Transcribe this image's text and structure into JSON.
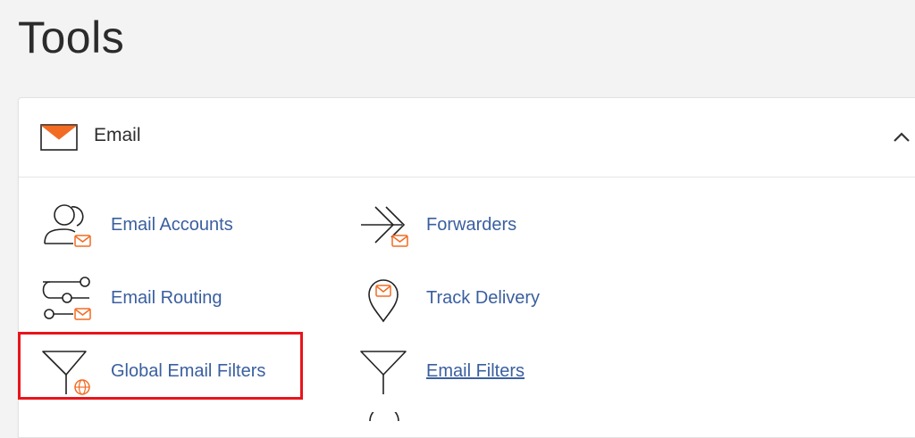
{
  "page": {
    "title": "Tools"
  },
  "email_section": {
    "title": "Email",
    "icon": "envelope-icon",
    "collapse_icon": "chevron-up-icon",
    "tools": [
      {
        "label": "Email Accounts",
        "icon": "email-accounts-icon"
      },
      {
        "label": "Forwarders",
        "icon": "forwarders-icon"
      },
      {
        "label": "Email Routing",
        "icon": "email-routing-icon"
      },
      {
        "label": "Track Delivery",
        "icon": "track-delivery-icon"
      },
      {
        "label": "Global Email Filters",
        "icon": "global-email-filters-icon",
        "highlighted": true
      },
      {
        "label": "Email Filters",
        "icon": "email-filters-icon"
      }
    ]
  },
  "colors": {
    "accent_orange": "#f26c23",
    "link_blue": "#3a5f9f",
    "highlight_red": "#e8141b"
  }
}
